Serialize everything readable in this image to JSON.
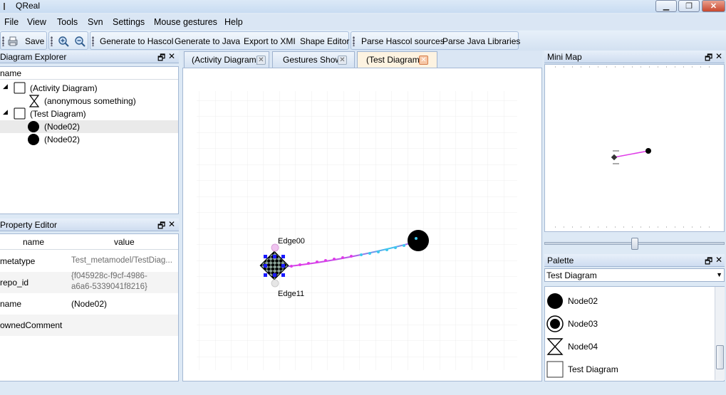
{
  "window": {
    "title": "QReal",
    "minimize_label": "▁",
    "restore_label": "❐",
    "close_label": "✕"
  },
  "menu": [
    "File",
    "View",
    "Tools",
    "Svn",
    "Settings",
    "Mouse gestures",
    "Help"
  ],
  "toolbar": {
    "save_label": "Save",
    "generate_hascol": "Generate to Hascol",
    "generate_java": "Generate to Java",
    "export_xmi": "Export to XMI",
    "shape_editor": "Shape Editor",
    "parse_hascol": "Parse Hascol sources",
    "parse_java": "Parse Java Libraries"
  },
  "dock_controls": {
    "float": "🗗",
    "close": "✕"
  },
  "diagram_explorer": {
    "title": "Diagram Explorer",
    "column_header": "name",
    "items": [
      {
        "label": "(Activity Diagram)",
        "level": 0,
        "icon": "diagram-icon"
      },
      {
        "label": "(anonymous something)",
        "level": 1,
        "icon": "hourglass-icon"
      },
      {
        "label": "(Test Diagram)",
        "level": 0,
        "icon": "diagram-icon"
      },
      {
        "label": "(Node02)",
        "level": 1,
        "icon": "filled-circle-icon",
        "selected": true
      },
      {
        "label": "(Node02)",
        "level": 1,
        "icon": "filled-circle-icon"
      }
    ]
  },
  "property_editor": {
    "title": "Property Editor",
    "columns": [
      "name",
      "value"
    ],
    "rows": [
      {
        "name": "metatype",
        "value": "Test_metamodel/TestDiag..."
      },
      {
        "name": "repo_id",
        "value": "{f045928c-f9cf-4986-",
        "value2": "a6a6-5339041f8216}"
      },
      {
        "name": "name",
        "value": "(Node02)"
      },
      {
        "name": "ownedComment",
        "value": ""
      }
    ]
  },
  "tabs": [
    {
      "label": "(Activity Diagram)",
      "active": false
    },
    {
      "label": "Gestures Show",
      "active": false
    },
    {
      "label": "(Test Diagram)",
      "active": true
    }
  ],
  "tab_close": "✕",
  "canvas": {
    "edge_top_label": "Edge00",
    "edge_bottom_label": "Edge11",
    "colors": {
      "edge_magenta": "#e03ce8",
      "edge_cyan": "#3cc8ee",
      "node": "#000000",
      "selection": "#1a1aff"
    }
  },
  "mini_map": {
    "title": "Mini Map"
  },
  "palette": {
    "title": "Palette",
    "selected": "Test Diagram",
    "items": [
      {
        "label": "Node02",
        "icon": "filled-circle-icon"
      },
      {
        "label": "Node03",
        "icon": "ring-circle-icon"
      },
      {
        "label": "Node04",
        "icon": "hourglass-icon"
      },
      {
        "label": "Test Diagram",
        "icon": "square-icon"
      }
    ]
  }
}
